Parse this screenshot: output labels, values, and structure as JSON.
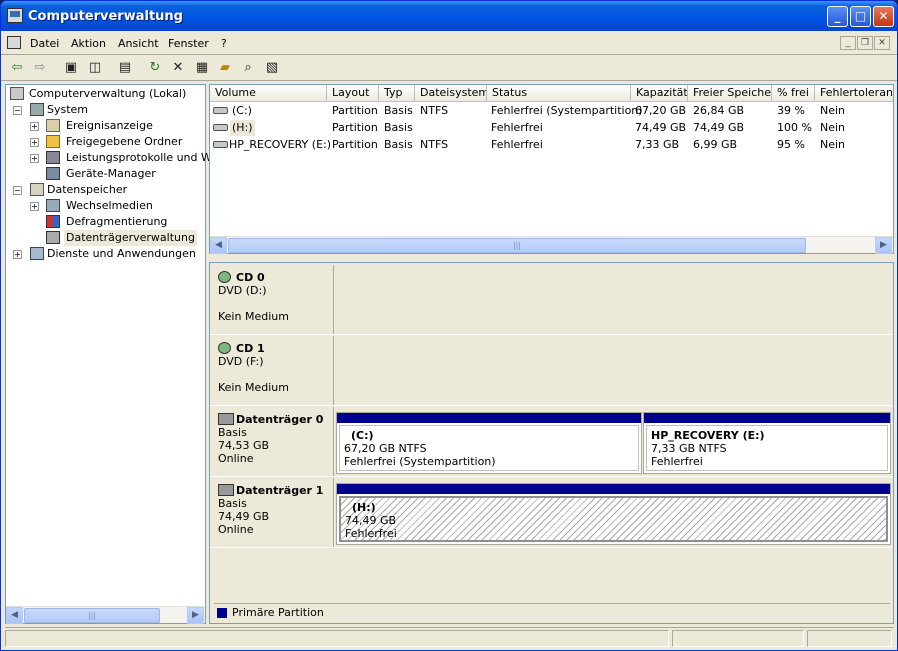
{
  "window": {
    "title": "Computerverwaltung"
  },
  "menu": {
    "items": [
      "Datei",
      "Aktion",
      "Ansicht",
      "Fenster",
      "?"
    ]
  },
  "tree": {
    "root": "Computerverwaltung (Lokal)",
    "system": "System",
    "ereignis": "Ereignisanzeige",
    "freigabe": "Freigegebene Ordner",
    "leistung": "Leistungsprotokolle und Warn",
    "geraete": "Geräte-Manager",
    "datenspeicher": "Datenspeicher",
    "wechsel": "Wechselmedien",
    "defrag": "Defragmentierung",
    "datentraeger": "Datenträgerverwaltung",
    "dienste": "Dienste und Anwendungen"
  },
  "columns": [
    "Volume",
    "Layout",
    "Typ",
    "Dateisystem",
    "Status",
    "Kapazität",
    "Freier Speicher",
    "% frei",
    "Fehlertoleranz"
  ],
  "volumes": [
    {
      "volume": "(C:)",
      "layout": "Partition",
      "typ": "Basis",
      "fs": "NTFS",
      "status": "Fehlerfrei (Systempartition)",
      "kap": "67,20 GB",
      "frei": "26,84 GB",
      "pct": "39 %",
      "ft": "Nein"
    },
    {
      "volume": "(H:)",
      "layout": "Partition",
      "typ": "Basis",
      "fs": "",
      "status": "Fehlerfrei",
      "kap": "74,49 GB",
      "frei": "74,49 GB",
      "pct": "100 %",
      "ft": "Nein"
    },
    {
      "volume": "HP_RECOVERY (E:)",
      "layout": "Partition",
      "typ": "Basis",
      "fs": "NTFS",
      "status": "Fehlerfrei",
      "kap": "7,33 GB",
      "frei": "6,99 GB",
      "pct": "95 %",
      "ft": "Nein"
    }
  ],
  "disks": {
    "cd0": {
      "name": "CD 0",
      "type": "DVD (D:)",
      "state": "Kein Medium"
    },
    "cd1": {
      "name": "CD 1",
      "type": "DVD (F:)",
      "state": "Kein Medium"
    },
    "d0": {
      "name": "Datenträger 0",
      "kind": "Basis",
      "size": "74,53 GB",
      "state": "Online",
      "p1": {
        "name": "(C:)",
        "size": "67,20 GB NTFS",
        "status": "Fehlerfrei (Systempartition)"
      },
      "p2": {
        "name": "HP_RECOVERY  (E:)",
        "size": "7,33 GB NTFS",
        "status": "Fehlerfrei"
      }
    },
    "d1": {
      "name": "Datenträger 1",
      "kind": "Basis",
      "size": "74,49 GB",
      "state": "Online",
      "p1": {
        "name": "(H:)",
        "size": "74,49 GB",
        "status": "Fehlerfrei"
      }
    }
  },
  "legend": {
    "primary": "Primäre Partition",
    "primary_color": "#00008b"
  },
  "scroll": {
    "grip": "|||"
  }
}
